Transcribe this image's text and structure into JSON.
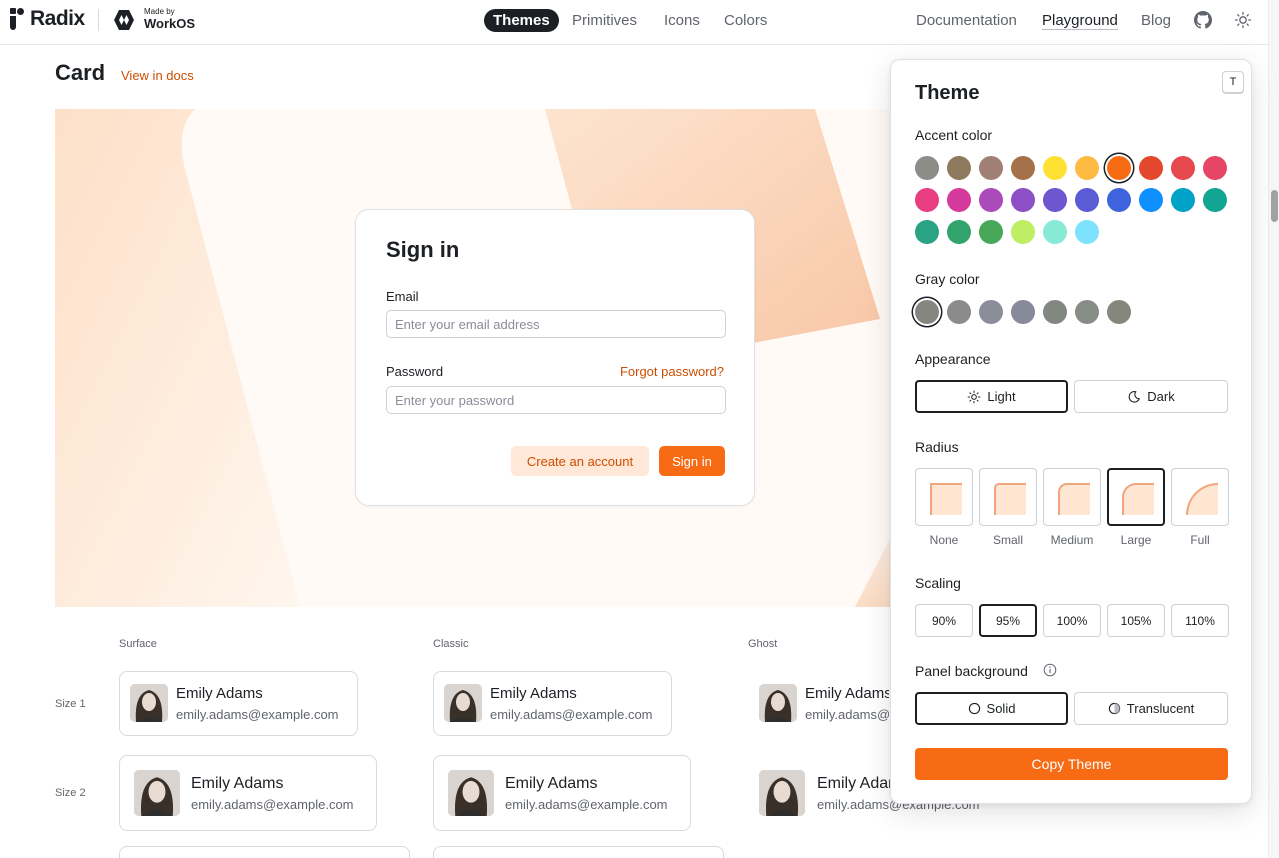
{
  "header": {
    "brand": "Radix",
    "made_by_small": "Made by",
    "made_by_name": "WorkOS",
    "nav_center": [
      "Themes",
      "Primitives",
      "Icons",
      "Colors"
    ],
    "nav_right": [
      "Documentation",
      "Playground",
      "Blog"
    ],
    "github_icon": "github-icon",
    "theme_toggle_icon": "sun-icon"
  },
  "page": {
    "title": "Card",
    "view_docs": "View in docs"
  },
  "signin": {
    "title": "Sign in",
    "email_label": "Email",
    "email_placeholder": "Enter your email address",
    "password_label": "Password",
    "password_placeholder": "Enter your password",
    "forgot": "Forgot password?",
    "create_account": "Create an account",
    "submit": "Sign in"
  },
  "variants": {
    "columns": [
      "Surface",
      "Classic",
      "Ghost"
    ],
    "rows": [
      "Size 1",
      "Size 2"
    ],
    "user": {
      "name": "Emily Adams",
      "email": "emily.adams@example.com"
    }
  },
  "theme_panel": {
    "title": "Theme",
    "shortcut": "T",
    "accent_label": "Accent color",
    "accent_colors": [
      "#8b8d87",
      "#8e7a5c",
      "#a08074",
      "#a5714a",
      "#ffe134",
      "#ffba43",
      "#f76b15",
      "#e5472c",
      "#e5484d",
      "#e54666",
      "#e93d82",
      "#d5399b",
      "#ab4aba",
      "#8e4ec6",
      "#6e56cf",
      "#5b5bd6",
      "#3e63dd",
      "#0f90ff",
      "#00a2c7",
      "#12a594",
      "#29a383",
      "#30a46c",
      "#46a758",
      "#bdee63",
      "#86ead4",
      "#7ce2fe"
    ],
    "accent_selected": 6,
    "gray_label": "Gray color",
    "gray_colors": [
      "#868580",
      "#8b8b8b",
      "#8b8d98",
      "#868a99",
      "#82877f",
      "#868d86",
      "#87867d"
    ],
    "gray_selected": 0,
    "appearance_label": "Appearance",
    "appearance_options": [
      "Light",
      "Dark"
    ],
    "appearance_selected": "Light",
    "radius_label": "Radius",
    "radius_options": [
      "None",
      "Small",
      "Medium",
      "Large",
      "Full"
    ],
    "radius_selected": "Large",
    "scaling_label": "Scaling",
    "scaling_options": [
      "90%",
      "95%",
      "100%",
      "105%",
      "110%"
    ],
    "scaling_selected": "95%",
    "panel_bg_label": "Panel background",
    "panel_bg_options": [
      "Solid",
      "Translucent"
    ],
    "panel_bg_selected": "Solid",
    "copy_button": "Copy Theme"
  }
}
